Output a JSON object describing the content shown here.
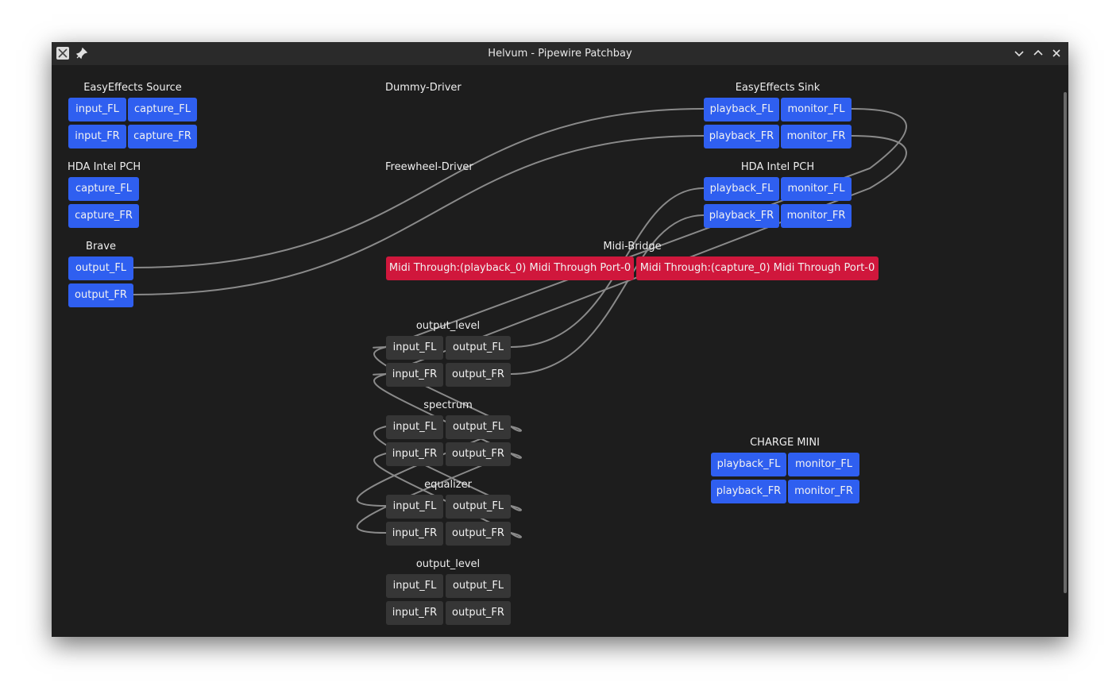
{
  "window": {
    "title": "Helvum - Pipewire Patchbay"
  },
  "nodes": {
    "ee_source": {
      "name": "EasyEffects Source",
      "ports": [
        "input_FL",
        "capture_FL",
        "input_FR",
        "capture_FR"
      ]
    },
    "dummy": {
      "name": "Dummy-Driver"
    },
    "ee_sink": {
      "name": "EasyEffects Sink",
      "ports": [
        "playback_FL",
        "monitor_FL",
        "playback_FR",
        "monitor_FR"
      ]
    },
    "hda_in": {
      "name": "HDA Intel PCH",
      "ports": [
        "capture_FL",
        "capture_FR"
      ]
    },
    "freewheel": {
      "name": "Freewheel-Driver"
    },
    "hda_out": {
      "name": "HDA Intel PCH",
      "ports": [
        "playback_FL",
        "monitor_FL",
        "playback_FR",
        "monitor_FR"
      ]
    },
    "brave": {
      "name": "Brave",
      "ports": [
        "output_FL",
        "output_FR"
      ]
    },
    "midi": {
      "name": "Midi-Bridge",
      "ports": [
        "Midi Through:(playback_0) Midi Through Port-0",
        "Midi Through:(capture_0) Midi Through Port-0"
      ]
    },
    "output_level": {
      "name": "output_level",
      "ports": [
        "input_FL",
        "output_FL",
        "input_FR",
        "output_FR"
      ]
    },
    "spectrum": {
      "name": "spectrum",
      "ports": [
        "input_FL",
        "output_FL",
        "input_FR",
        "output_FR"
      ]
    },
    "equalizer": {
      "name": "equalizer",
      "ports": [
        "input_FL",
        "output_FL",
        "input_FR",
        "output_FR"
      ]
    },
    "output_level2": {
      "name": "output_level",
      "ports": [
        "input_FL",
        "output_FL",
        "input_FR",
        "output_FR"
      ]
    },
    "charge": {
      "name": "CHARGE MINI",
      "ports": [
        "playback_FL",
        "monitor_FL",
        "playback_FR",
        "monitor_FR"
      ]
    }
  },
  "colors": {
    "background": "#1d1d1d",
    "titlebar": "#2a2a2a",
    "audio_port": "#2f5ff0",
    "filter_port": "#363636",
    "midi_port": "#d0173c",
    "link": "#8a8a8a"
  }
}
